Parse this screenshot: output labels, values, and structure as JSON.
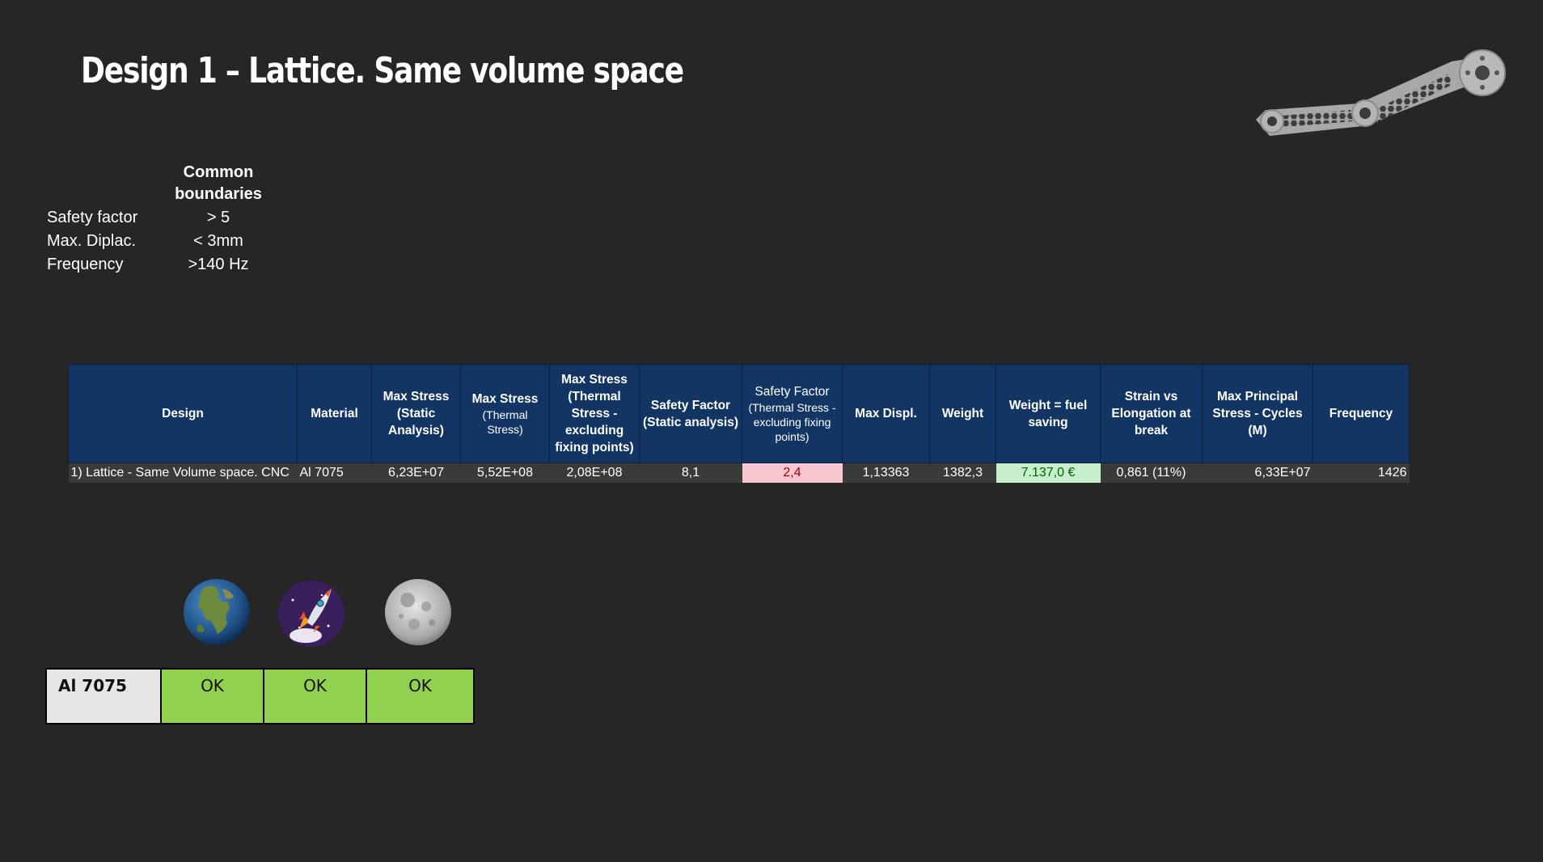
{
  "slide": {
    "title": "Design 1 – Lattice. Same volume space"
  },
  "boundaries": {
    "header": "Common boundaries",
    "rows": [
      {
        "label": "Safety factor",
        "value": "> 5"
      },
      {
        "label": "Max. Diplac.",
        "value": "< 3mm"
      },
      {
        "label": "Frequency",
        "value": ">140 Hz"
      }
    ]
  },
  "results_table": {
    "headers": [
      {
        "main": "Design",
        "sub": ""
      },
      {
        "main": "Material",
        "sub": ""
      },
      {
        "main": "Max Stress (Static Analysis)",
        "sub": ""
      },
      {
        "main": "Max Stress",
        "sub": "(Thermal Stress)"
      },
      {
        "main": "Max Stress (Thermal Stress - excluding fixing points)",
        "sub": ""
      },
      {
        "main": "Safety Factor (Static analysis)",
        "sub": ""
      },
      {
        "main": "Safety Factor",
        "sub": "(Thermal Stress - excluding fixing points)"
      },
      {
        "main": "Max Displ.",
        "sub": ""
      },
      {
        "main": "Weight",
        "sub": ""
      },
      {
        "main": "Weight = fuel saving",
        "sub": ""
      },
      {
        "main": "Strain vs Elongation at break",
        "sub": ""
      },
      {
        "main": "Max Principal Stress - Cycles (M)",
        "sub": ""
      },
      {
        "main": "Frequency",
        "sub": ""
      }
    ],
    "rows": [
      [
        "1) Lattice - Same Volume space. CNC",
        "Al 7075",
        "6,23E+07",
        "5,52E+08",
        "2,08E+08",
        "8,1",
        "2,4",
        "1,13363",
        "1382,3",
        "7.137,0 €",
        "0,861 (11%)",
        "6,33E+07",
        "1426"
      ]
    ],
    "highlight_colors": {
      "warn_bg": "#f7c6cf",
      "warn_fg": "#9c0006",
      "good_bg": "#c6efce",
      "good_fg": "#006100"
    },
    "header_color": "#133563"
  },
  "environments": {
    "icons": [
      "earth-icon",
      "rocket-icon",
      "moon-icon"
    ],
    "material": "Al 7075",
    "results": [
      "OK",
      "OK",
      "OK"
    ],
    "ok_color": "#92d050"
  }
}
